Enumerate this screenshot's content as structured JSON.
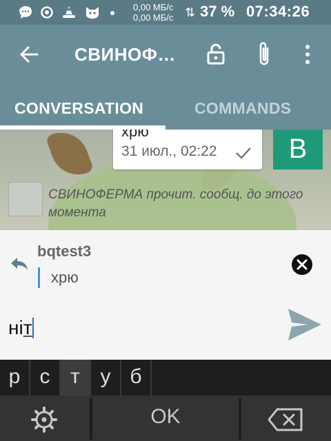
{
  "status_bar": {
    "net_up": "0,00 МБ/с",
    "net_down": "0,00 МБ/с",
    "arrows": "⇅",
    "battery": "37 %",
    "time": "07:34:26",
    "icons": [
      "chat-icon",
      "circle-dot-icon",
      "cone-icon",
      "cat-icon",
      "dot-icon"
    ]
  },
  "app_bar": {
    "title": "СВИНОФ…",
    "icons": [
      "back-arrow-icon",
      "lock-icon",
      "paperclip-icon",
      "more-vert-icon"
    ]
  },
  "tabs": [
    {
      "label": "CONVERSATION",
      "active": true
    },
    {
      "label": "COMMANDS",
      "active": false
    }
  ],
  "chat": {
    "bubble_text": "хрю",
    "bubble_time": "31 июл., 02:22",
    "avatar_letter": "B",
    "read_receipt": "СВИНОФЕРМА прочит. сообщ. до этого момента"
  },
  "reply": {
    "name": "bqtest3",
    "text": "хрю"
  },
  "input": {
    "prefix": "ні",
    "underlined": "т"
  },
  "keyboard": {
    "suggestions": [
      "р",
      "с",
      "т",
      "у",
      "б"
    ],
    "active_index": 2,
    "ok_label": "OK"
  },
  "colors": {
    "status_bar": "#5a7a86",
    "app_bar": "#6a8d9a",
    "avatar": "#1f9a78",
    "send": "#8aa6b0",
    "keyboard": "#333333"
  }
}
